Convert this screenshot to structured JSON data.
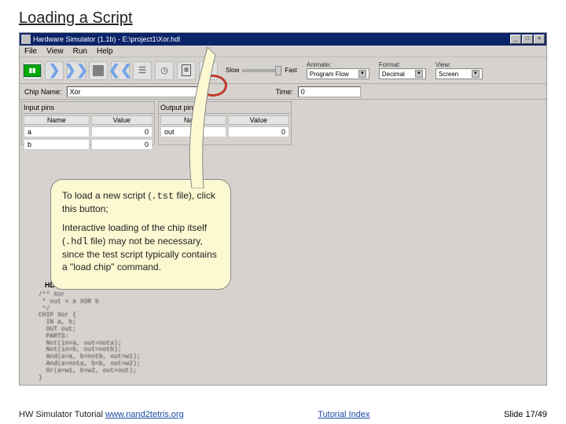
{
  "slide_title": "Loading a Script",
  "window": {
    "title": "Hardware Simulator (1.1b) - E:\\project1\\Xor.hdl"
  },
  "menu": {
    "file": "File",
    "view": "View",
    "run": "Run",
    "help": "Help"
  },
  "toolbar": {
    "slow_label": "Slow",
    "fast_label": "Fast",
    "animate_label": "Animate:",
    "animate_value": "Program Flow",
    "format_label": "Format:",
    "format_value": "Decimal",
    "view_label": "View:",
    "view_value": "Screen"
  },
  "subbar": {
    "chipname_label": "Chip Name:",
    "chipname_value": "Xor",
    "time_label": "Time:",
    "time_value": "0"
  },
  "pins": {
    "input_header": "Input pins",
    "output_header": "Output pins",
    "cols": {
      "name": "Name",
      "value": "Value"
    },
    "input_rows": [
      {
        "name": "a",
        "value": "0"
      },
      {
        "name": "b",
        "value": "0"
      }
    ],
    "output_rows": [
      {
        "name": "out",
        "value": "0"
      }
    ]
  },
  "callout": {
    "p1_a": "To load a new script (",
    "p1_code": ".tst",
    "p1_b": " file), click this button;",
    "p2_a": "Interactive loading of the chip itself (",
    "p2_code": ".hdl",
    "p2_b": " file) may not be necessary, since the test script typically contains a \"load chip\" command."
  },
  "hdl": {
    "label": "HDL",
    "code": "/** Xor\n * out = a XOR b\n */\nCHIP Xor {\n  IN a, b;\n  OUT out;\n  PARTS:\n  Not(in=a, out=nota);\n  Not(in=b, out=notb);\n  And(a=a, b=notb, out=w1);\n  And(a=nota, b=b, out=w2);\n  Or(a=w1, b=w2, out=out);\n}"
  },
  "footer": {
    "tutorial_text": "HW Simulator Tutorial ",
    "tutorial_link": "www.nand2tetris.org",
    "index_link": "Tutorial Index",
    "slide_counter": "Slide 17/49"
  }
}
